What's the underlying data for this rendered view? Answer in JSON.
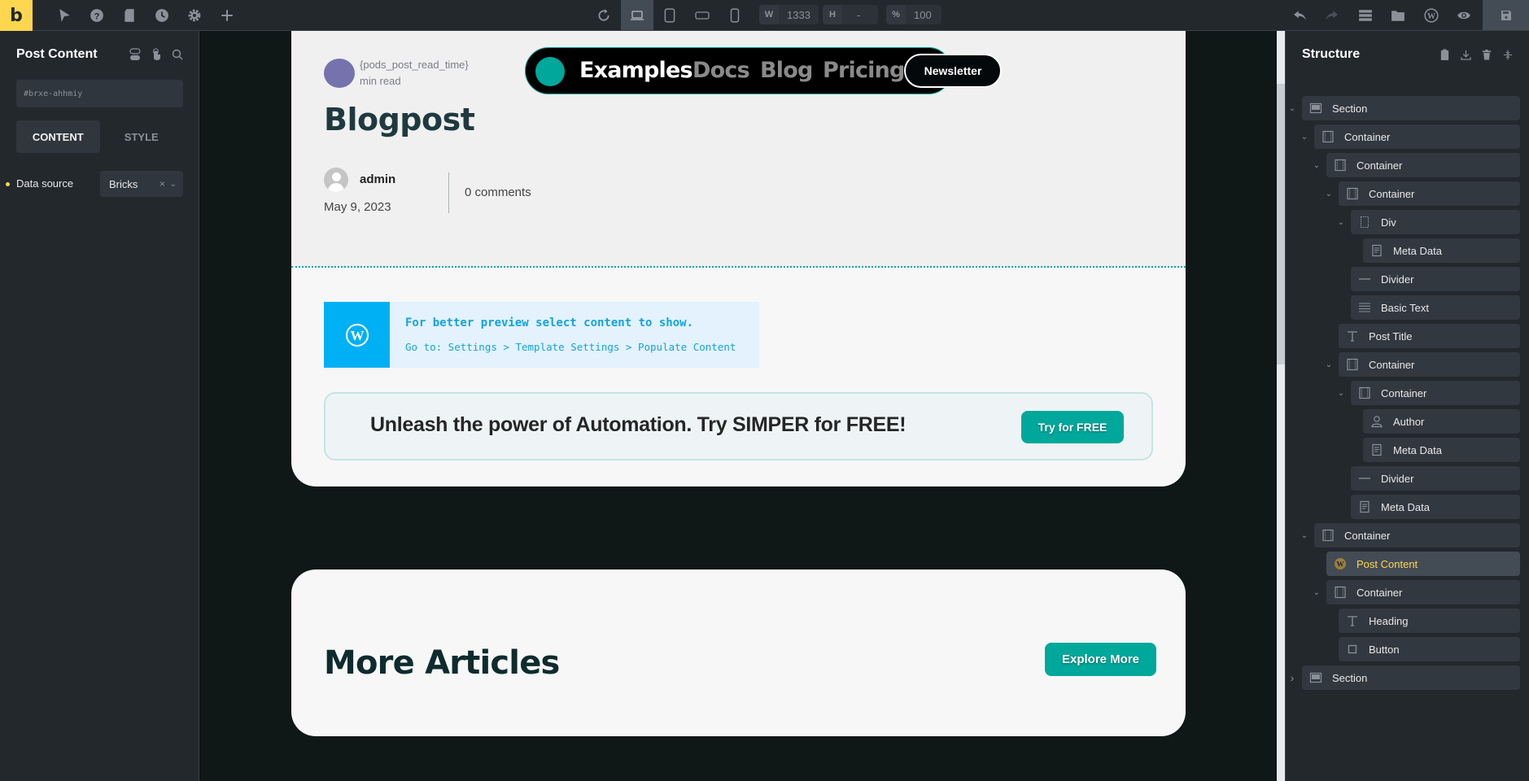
{
  "topbar": {
    "logo": "b",
    "left_icons": [
      "cursor-icon",
      "help-icon",
      "page-icon",
      "history-icon",
      "settings-icon",
      "add-icon"
    ],
    "breakpoints": [
      {
        "name": "desktop",
        "active": true
      },
      {
        "name": "tablet-portrait",
        "active": false
      },
      {
        "name": "mobile-landscape",
        "active": false
      },
      {
        "name": "mobile-portrait",
        "active": false
      }
    ],
    "width_label": "W",
    "width_value": "1333",
    "height_label": "H",
    "height_value": "-",
    "zoom_label": "%",
    "zoom_value": "100",
    "right_icons": [
      "undo-icon",
      "redo-icon",
      "structure-icon",
      "templates-icon",
      "wordpress-icon",
      "preview-icon"
    ],
    "save_icon": "save-icon"
  },
  "left_panel": {
    "title": "Post Content",
    "element_id": "#brxe-ahhmiy",
    "tabs": [
      {
        "label": "CONTENT",
        "active": true
      },
      {
        "label": "STYLE",
        "active": false
      }
    ],
    "controls": [
      {
        "label": "Data source",
        "value": "Bricks",
        "clear": "×",
        "modified": true
      }
    ]
  },
  "canvas": {
    "read_time_placeholder": "{pods_post_read_time}",
    "read_time_suffix": "min read",
    "post_title": "Blogpost",
    "author": "admin",
    "date": "May 9, 2023",
    "comments": "0 comments",
    "nav": {
      "links": [
        {
          "label": "Examples",
          "active": true
        },
        {
          "label": "Docs",
          "active": false
        },
        {
          "label": "Blog",
          "active": false
        },
        {
          "label": "Pricing",
          "active": false
        }
      ],
      "newsletter": "Newsletter"
    },
    "notice": {
      "line1": "For better preview select content to show.",
      "line2": "Go to: Settings > Template Settings > Populate Content"
    },
    "cta": {
      "text": "Unleash the power of Automation. Try SIMPER for FREE!",
      "button": "Try for FREE"
    },
    "more": {
      "title": "More Articles",
      "button": "Explore More"
    },
    "colors": {
      "accent": "#00a89b",
      "brand_yellow": "#ffd64f",
      "notice_blue": "#00b0f4"
    }
  },
  "structure": {
    "title": "Structure",
    "header_icons": [
      "clipboard-icon",
      "download-icon",
      "trash-icon",
      "collapse-icon"
    ],
    "items": [
      {
        "label": "Section",
        "icon": "section",
        "depth": 0,
        "toggle": "open"
      },
      {
        "label": "Container",
        "icon": "container",
        "depth": 1,
        "toggle": "open"
      },
      {
        "label": "Container",
        "icon": "container",
        "depth": 2,
        "toggle": "open"
      },
      {
        "label": "Container",
        "icon": "container",
        "depth": 3,
        "toggle": "open"
      },
      {
        "label": "Div",
        "icon": "div",
        "depth": 4,
        "toggle": "open"
      },
      {
        "label": "Meta Data",
        "icon": "meta",
        "depth": 5,
        "toggle": ""
      },
      {
        "label": "Divider",
        "icon": "divider",
        "depth": 4,
        "toggle": ""
      },
      {
        "label": "Basic Text",
        "icon": "text",
        "depth": 4,
        "toggle": ""
      },
      {
        "label": "Post Title",
        "icon": "heading",
        "depth": 3,
        "toggle": ""
      },
      {
        "label": "Container",
        "icon": "container",
        "depth": 3,
        "toggle": "open"
      },
      {
        "label": "Container",
        "icon": "container",
        "depth": 4,
        "toggle": "open"
      },
      {
        "label": "Author",
        "icon": "author",
        "depth": 5,
        "toggle": ""
      },
      {
        "label": "Meta Data",
        "icon": "meta",
        "depth": 5,
        "toggle": ""
      },
      {
        "label": "Divider",
        "icon": "divider",
        "depth": 4,
        "toggle": ""
      },
      {
        "label": "Meta Data",
        "icon": "meta",
        "depth": 4,
        "toggle": ""
      },
      {
        "label": "Container",
        "icon": "container",
        "depth": 1,
        "toggle": "open"
      },
      {
        "label": "Post Content",
        "icon": "wordpress",
        "depth": 2,
        "toggle": "",
        "selected": true
      },
      {
        "label": "Container",
        "icon": "container",
        "depth": 2,
        "toggle": "open"
      },
      {
        "label": "Heading",
        "icon": "heading",
        "depth": 3,
        "toggle": ""
      },
      {
        "label": "Button",
        "icon": "button",
        "depth": 3,
        "toggle": ""
      },
      {
        "label": "Section",
        "icon": "section",
        "depth": 0,
        "toggle": "closed"
      }
    ]
  }
}
